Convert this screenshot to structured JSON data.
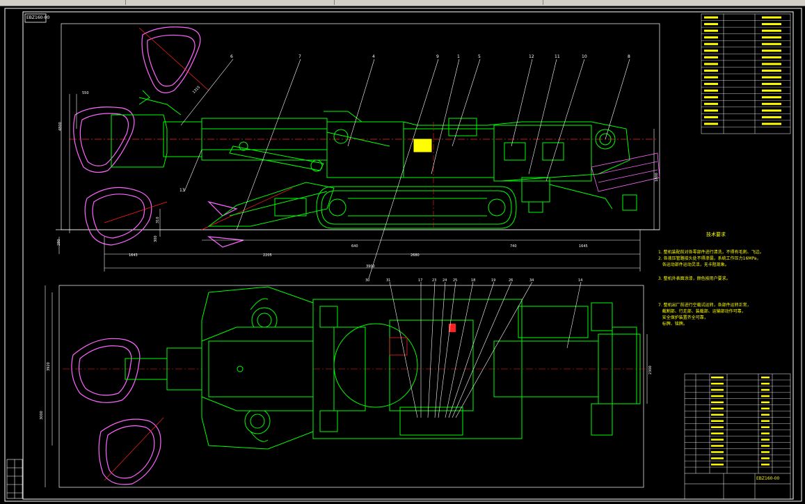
{
  "window": {
    "sheet_label": "EBZ160-00"
  },
  "callouts": {
    "side_view": [
      "6",
      "7",
      "4",
      "9",
      "1",
      "5",
      "12",
      "11",
      "10",
      "8",
      "13"
    ],
    "plan_view": [
      "31",
      "17",
      "23",
      "24",
      "25",
      "18",
      "19",
      "26",
      "34",
      "14",
      "30"
    ]
  },
  "dimensions": {
    "side_view": [
      "550",
      "4800",
      "1315",
      "1800",
      "310",
      "1643",
      "2205",
      "2680",
      "640",
      "3900",
      "740",
      "1645",
      "280",
      "300"
    ],
    "plan_view": [
      "2300",
      "3000",
      "3920"
    ]
  },
  "tech_requirements": {
    "title": "技术要求",
    "items": [
      "1. 整机装配前对各零部件进行清洗，不得有毛刺、飞边。",
      "2. 各液压管路接头处不得渗漏，系统工作压力16MPa，",
      "   各运动部件运动灵活，无卡阻现象。",
      "3. 整机外表面涂漆，颜色按用户要求。",
      "7. 整机出厂前进行空载试运转，各部件运转正常，",
      "   截割部、行走部、装载部、运输部动作可靠，",
      "   安全保护装置齐全可靠，",
      "   标牌、铭牌。"
    ]
  },
  "spec_table": {
    "rows": 18
  },
  "bom_table": {
    "rows": 16,
    "title_block": "EBZ160-00"
  },
  "colors": {
    "line": "#00ff00",
    "cutter": "#ff66ff",
    "centerline": "#ff2020",
    "text": "#ffff00",
    "frame": "#ffffff",
    "leader": "#ffffff",
    "dim": "#ffffff"
  }
}
